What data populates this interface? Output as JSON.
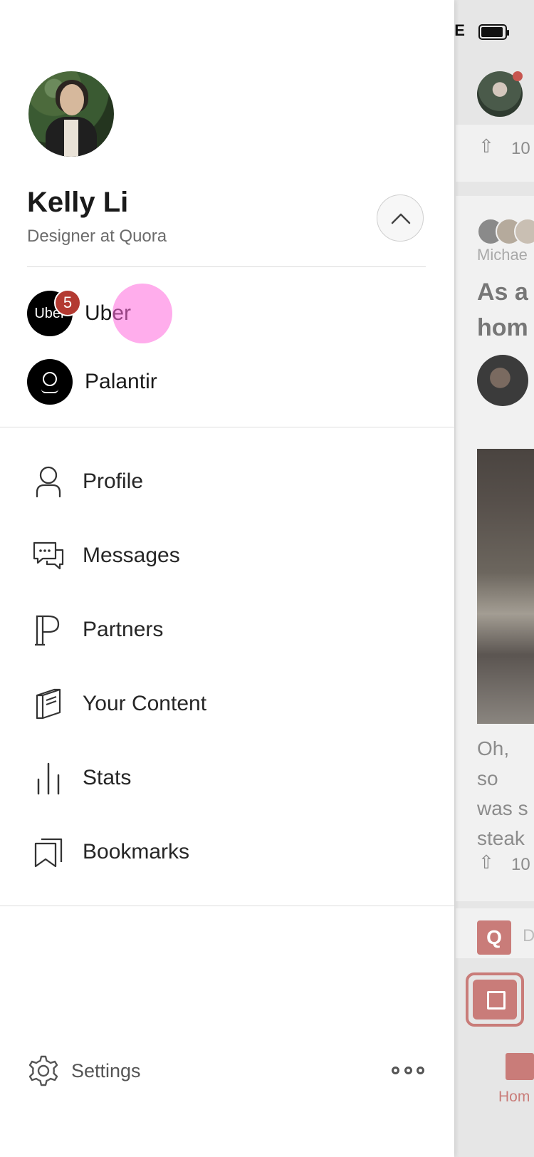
{
  "status_bar": {
    "network": "LTE"
  },
  "drawer": {
    "user": {
      "name": "Kelly Li",
      "tagline": "Designer at Quora"
    },
    "spaces": [
      {
        "label": "Uber",
        "logo_text": "Uber",
        "badge": "5"
      },
      {
        "label": "Palantir"
      }
    ],
    "menu": [
      {
        "label": "Profile",
        "icon": "person-icon"
      },
      {
        "label": "Messages",
        "icon": "chat-bubbles-icon"
      },
      {
        "label": "Partners",
        "icon": "partners-p-icon"
      },
      {
        "label": "Your Content",
        "icon": "book-icon"
      },
      {
        "label": "Stats",
        "icon": "bar-chart-icon"
      },
      {
        "label": "Bookmarks",
        "icon": "bookmarks-icon"
      }
    ],
    "footer": {
      "settings_label": "Settings"
    }
  },
  "background_feed": {
    "upvote_count_1": "10",
    "author_partial": "Michae",
    "title_partial": "As a\nhom",
    "body_partial": "Oh, so\nwas s\nsteak",
    "upvote_count_2": "10",
    "space_letter": "Q",
    "space_partial": "D",
    "home_label": "Hom"
  },
  "colors": {
    "badge": "#b33a32",
    "accent": "#c97c79",
    "tap_indicator": "#ff69dc"
  }
}
